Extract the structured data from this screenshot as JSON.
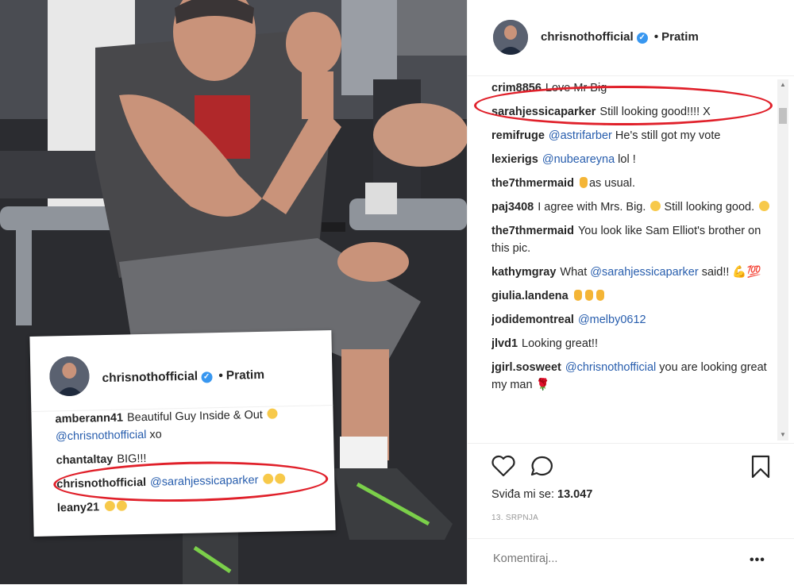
{
  "post": {
    "username": "chrisnothofficial",
    "separator": "•",
    "follow_label": "Pratim",
    "comments": [
      {
        "user": "crim8856",
        "parts": [
          {
            "t": "Love Mr Big"
          }
        ]
      },
      {
        "user": "sarahjessicaparker",
        "parts": [
          {
            "t": "Still looking good!!!! X"
          }
        ]
      },
      {
        "user": "remifruge",
        "parts": [
          {
            "t": "@astrifarber",
            "m": true
          },
          {
            "t": " He's still got my vote"
          }
        ]
      },
      {
        "user": "lexierigs",
        "parts": [
          {
            "t": "@nubeareyna",
            "m": true
          },
          {
            "t": " lol !"
          }
        ]
      },
      {
        "user": "the7thmermaid",
        "parts": [
          {
            "e": "clap"
          },
          {
            "t": "as usual."
          }
        ]
      },
      {
        "user": "paj3408",
        "parts": [
          {
            "t": "I agree with Mrs. Big. "
          },
          {
            "e": "smile"
          },
          {
            "t": " Still looking good. "
          },
          {
            "e": "smile"
          }
        ]
      },
      {
        "user": "the7thmermaid",
        "parts": [
          {
            "t": "You look like Sam Elliot's brother on this pic."
          }
        ]
      },
      {
        "user": "kathymgray",
        "parts": [
          {
            "t": "What "
          },
          {
            "t": "@sarahjessicaparker",
            "m": true
          },
          {
            "t": " said!! 💪💯"
          }
        ]
      },
      {
        "user": "giulia.landena",
        "parts": [
          {
            "e": "clap"
          },
          {
            "e": "clap"
          },
          {
            "e": "clap"
          }
        ]
      },
      {
        "user": "jodidemontreal",
        "parts": [
          {
            "t": "@melby0612",
            "m": true
          }
        ]
      },
      {
        "user": "jlvd1",
        "parts": [
          {
            "t": "Looking great!!"
          }
        ]
      },
      {
        "user": "jgirl.sosweet",
        "parts": [
          {
            "t": "@chrisnothofficial",
            "m": true
          },
          {
            "t": " you are looking great my man 🌹"
          }
        ]
      }
    ],
    "likes_label": "Sviđa mi se:",
    "likes_count": "13.047",
    "date": "13. SRPNJA",
    "comment_placeholder": "Komentiraj...",
    "more_label": "•••",
    "icons": [
      "heart-icon",
      "comment-icon",
      "bookmark-icon"
    ]
  },
  "inset": {
    "username": "chrisnothofficial",
    "separator": "•",
    "follow_label": "Pratim",
    "comments": [
      {
        "user": "amberann41",
        "parts": [
          {
            "t": "Beautiful Guy Inside & Out "
          },
          {
            "e": "smile"
          },
          {
            "t": " "
          },
          {
            "t": "@chrisnothofficial",
            "m": true
          },
          {
            "t": " xo"
          }
        ]
      },
      {
        "user": "chantaltay",
        "parts": [
          {
            "t": "BIG!!!"
          }
        ]
      },
      {
        "user": "chrisnothofficial",
        "parts": [
          {
            "t": "@sarahjessicaparker",
            "m": true
          },
          {
            "t": " "
          },
          {
            "e": "smile"
          },
          {
            "e": "smile"
          }
        ]
      },
      {
        "user": "leany21",
        "parts": [
          {
            "e": "smile"
          },
          {
            "e": "smile"
          }
        ]
      }
    ]
  },
  "colors": {
    "accent_blue": "#3897f0",
    "mention": "#275dad",
    "highlight_red": "#e0202a"
  }
}
